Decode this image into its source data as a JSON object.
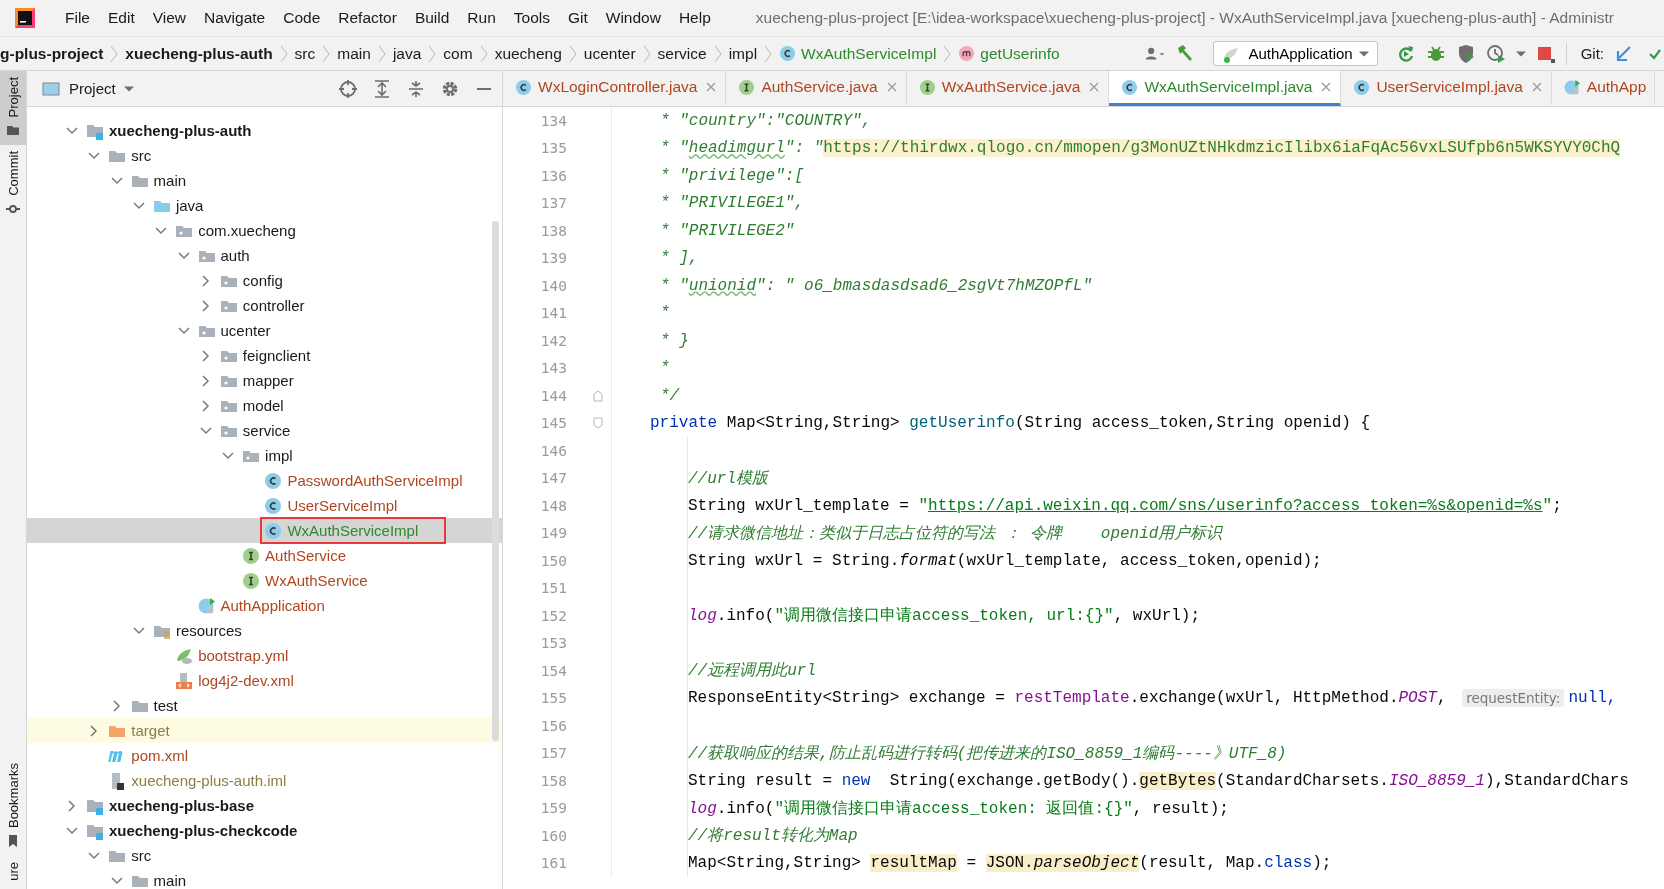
{
  "window": {
    "title": "xuecheng-plus-project [E:\\idea-workspace\\xuecheng-plus-project] - WxAuthServiceImpl.java [xuecheng-plus-auth] - Administr"
  },
  "menu": [
    "File",
    "Edit",
    "View",
    "Navigate",
    "Code",
    "Refactor",
    "Build",
    "Run",
    "Tools",
    "Git",
    "Window",
    "Help"
  ],
  "breadcrumb": [
    {
      "label": "g-plus-project",
      "kind": "module"
    },
    {
      "label": "xuecheng-plus-auth",
      "kind": "module"
    },
    {
      "label": "src",
      "kind": "folder"
    },
    {
      "label": "main",
      "kind": "folder"
    },
    {
      "label": "java",
      "kind": "folder"
    },
    {
      "label": "com",
      "kind": "folder"
    },
    {
      "label": "xuecheng",
      "kind": "folder"
    },
    {
      "label": "ucenter",
      "kind": "folder"
    },
    {
      "label": "service",
      "kind": "folder"
    },
    {
      "label": "impl",
      "kind": "folder"
    },
    {
      "label": "WxAuthServiceImpl",
      "kind": "class"
    },
    {
      "label": "getUserinfo",
      "kind": "method"
    }
  ],
  "toolbar": {
    "run_config": "AuthApplication",
    "git_label": "Git:"
  },
  "side_stripe": [
    {
      "label": "Project",
      "kind": "top",
      "selected": true
    },
    {
      "label": "Commit",
      "kind": "top",
      "selected": false
    },
    {
      "label": "Bookmarks",
      "kind": "bottom",
      "selected": false
    },
    {
      "label": "ure",
      "kind": "bottom",
      "selected": false
    }
  ],
  "project_panel": {
    "title": "Project",
    "tree": [
      {
        "label": "xuecheng-plus-auth",
        "kind": "module",
        "expanded": true,
        "selected": false,
        "children": [
          {
            "label": "src",
            "kind": "folder",
            "expanded": true,
            "selected": false,
            "children": [
              {
                "label": "main",
                "kind": "folder",
                "expanded": true,
                "selected": false,
                "children": [
                  {
                    "label": "java",
                    "kind": "source",
                    "expanded": true,
                    "selected": false,
                    "children": [
                      {
                        "label": "com.xuecheng",
                        "kind": "package",
                        "expanded": true,
                        "selected": false,
                        "children": [
                          {
                            "label": "auth",
                            "kind": "package",
                            "expanded": true,
                            "selected": false,
                            "children": [
                              {
                                "label": "config",
                                "kind": "package",
                                "expanded": false,
                                "selected": false
                              },
                              {
                                "label": "controller",
                                "kind": "package",
                                "expanded": false,
                                "selected": false
                              }
                            ]
                          },
                          {
                            "label": "ucenter",
                            "kind": "package",
                            "expanded": true,
                            "selected": false,
                            "children": [
                              {
                                "label": "feignclient",
                                "kind": "package",
                                "expanded": false,
                                "selected": false
                              },
                              {
                                "label": "mapper",
                                "kind": "package",
                                "expanded": false,
                                "selected": false
                              },
                              {
                                "label": "model",
                                "kind": "package",
                                "expanded": false,
                                "selected": false
                              },
                              {
                                "label": "service",
                                "kind": "package",
                                "expanded": true,
                                "selected": false,
                                "children": [
                                  {
                                    "label": "impl",
                                    "kind": "package",
                                    "expanded": true,
                                    "selected": false,
                                    "children": [
                                      {
                                        "label": "PasswordAuthServiceImpl",
                                        "kind": "class",
                                        "selected": false,
                                        "color": "#b0461f"
                                      },
                                      {
                                        "label": "UserServiceImpl",
                                        "kind": "class",
                                        "selected": false,
                                        "color": "#b0461f"
                                      },
                                      {
                                        "label": "WxAuthServiceImpl",
                                        "kind": "class",
                                        "selected": true,
                                        "outlined": true,
                                        "color": "#2d8a2d"
                                      }
                                    ]
                                  },
                                  {
                                    "label": "AuthService",
                                    "kind": "interface",
                                    "selected": false,
                                    "color": "#b0461f"
                                  },
                                  {
                                    "label": "WxAuthService",
                                    "kind": "interface",
                                    "selected": false,
                                    "color": "#b0461f"
                                  }
                                ]
                              }
                            ]
                          },
                          {
                            "label": "AuthApplication",
                            "kind": "app",
                            "selected": false,
                            "color": "#b0461f"
                          }
                        ]
                      }
                    ]
                  },
                  {
                    "label": "resources",
                    "kind": "resources",
                    "expanded": true,
                    "selected": false,
                    "children": [
                      {
                        "label": "bootstrap.yml",
                        "kind": "yaml",
                        "selected": false,
                        "color": "#b0461f"
                      },
                      {
                        "label": "log4j2-dev.xml",
                        "kind": "xml",
                        "selected": false,
                        "color": "#b0461f"
                      }
                    ]
                  }
                ]
              },
              {
                "label": "test",
                "kind": "folder",
                "expanded": false,
                "selected": false
              }
            ]
          },
          {
            "label": "target",
            "kind": "excluded",
            "expanded": false,
            "selected": false,
            "color": "#8a7f45"
          },
          {
            "label": "pom.xml",
            "kind": "maven",
            "selected": false,
            "color": "#b0461f"
          },
          {
            "label": "xuecheng-plus-auth.iml",
            "kind": "iml",
            "selected": false,
            "color": "#8a7f45"
          }
        ]
      },
      {
        "label": "xuecheng-plus-base",
        "kind": "module",
        "expanded": false,
        "selected": false
      },
      {
        "label": "xuecheng-plus-checkcode",
        "kind": "module",
        "expanded": true,
        "selected": false,
        "children": [
          {
            "label": "src",
            "kind": "folder",
            "expanded": true,
            "selected": false,
            "children": [
              {
                "label": "main",
                "kind": "folder",
                "expanded": true,
                "selected": false
              }
            ]
          }
        ]
      }
    ]
  },
  "editor": {
    "tabs": [
      {
        "label": "WxLoginController.java",
        "kind": "class",
        "selected": false,
        "closable": true,
        "color": "#b0461f"
      },
      {
        "label": "AuthService.java",
        "kind": "interface",
        "selected": false,
        "closable": true,
        "color": "#b0461f"
      },
      {
        "label": "WxAuthService.java",
        "kind": "interface",
        "selected": false,
        "closable": true,
        "color": "#b0461f"
      },
      {
        "label": "WxAuthServiceImpl.java",
        "kind": "class",
        "selected": true,
        "closable": true,
        "color": "#2d8a2d"
      },
      {
        "label": "UserServiceImpl.java",
        "kind": "class",
        "selected": false,
        "closable": true,
        "color": "#b0461f"
      },
      {
        "label": "AuthApp",
        "kind": "app",
        "selected": false,
        "closable": false,
        "color": "#b0461f"
      }
    ],
    "lines": [
      {
        "number": "134",
        "kind": "doc",
        "tokens": [
          {
            "kind": "doc",
            "text": "* \"country\":\"COUNTRY\","
          }
        ]
      },
      {
        "number": "135",
        "kind": "doc",
        "tokens": [
          {
            "kind": "doc",
            "text": "* \""
          },
          {
            "kind": "doc-typo",
            "text": "headimgurl"
          },
          {
            "kind": "doc",
            "text": "\": \""
          },
          {
            "kind": "doc-link",
            "text": "https://thirdwx.qlogo.cn/mmopen/g3MonUZtNHkdmzicIlibx6iaFqAc56vxLSUfpb6n5WKSYVY0ChQ"
          }
        ]
      },
      {
        "number": "136",
        "kind": "doc",
        "tokens": [
          {
            "kind": "doc",
            "text": "* \"privilege\":["
          }
        ]
      },
      {
        "number": "137",
        "kind": "doc",
        "tokens": [
          {
            "kind": "doc",
            "text": "* \"PRIVILEGE1\","
          }
        ]
      },
      {
        "number": "138",
        "kind": "doc",
        "tokens": [
          {
            "kind": "doc",
            "text": "* \"PRIVILEGE2\""
          }
        ]
      },
      {
        "number": "139",
        "kind": "doc",
        "tokens": [
          {
            "kind": "doc",
            "text": "* ],"
          }
        ]
      },
      {
        "number": "140",
        "kind": "doc",
        "tokens": [
          {
            "kind": "doc",
            "text": "* \""
          },
          {
            "kind": "doc-typo",
            "text": "unionid"
          },
          {
            "kind": "doc",
            "text": "\": \" o6_bmasdasdsad6_2sgVt7hMZOPfL\""
          }
        ]
      },
      {
        "number": "141",
        "kind": "doc",
        "tokens": [
          {
            "kind": "doc",
            "text": "*"
          }
        ]
      },
      {
        "number": "142",
        "kind": "doc",
        "tokens": [
          {
            "kind": "doc",
            "text": "* }"
          }
        ]
      },
      {
        "number": "143",
        "kind": "doc",
        "tokens": [
          {
            "kind": "doc",
            "text": "*"
          }
        ]
      },
      {
        "number": "144",
        "kind": "doc",
        "fold_end": true,
        "tokens": [
          {
            "kind": "doc",
            "text": "*/"
          }
        ]
      },
      {
        "number": "145",
        "kind": "member",
        "fold_start": true,
        "tokens": [
          {
            "kind": "keyword",
            "text": "private"
          },
          {
            "kind": "plain",
            "text": " Map<String,String> "
          },
          {
            "kind": "decl",
            "text": "getUserinfo"
          },
          {
            "kind": "plain",
            "text": "(String access_token,String openid) {"
          }
        ]
      },
      {
        "number": "146",
        "kind": "blank"
      },
      {
        "number": "147",
        "kind": "body",
        "tokens": [
          {
            "kind": "comment",
            "text": "//url模版"
          }
        ]
      },
      {
        "number": "148",
        "kind": "body",
        "tokens": [
          {
            "kind": "plain",
            "text": "String wxUrl_template = "
          },
          {
            "kind": "string",
            "text": "\""
          },
          {
            "kind": "url",
            "text": "https://api.weixin.qq.com/sns/userinfo?access_token=%s&openid=%s"
          },
          {
            "kind": "string",
            "text": "\""
          },
          {
            "kind": "plain",
            "text": ";"
          }
        ]
      },
      {
        "number": "149",
        "kind": "body",
        "tokens": [
          {
            "kind": "comment",
            "text": "//请求微信地址：类似于日志占位符的写法 ： 令牌    openid用户标识"
          }
        ]
      },
      {
        "number": "150",
        "kind": "body",
        "tokens": [
          {
            "kind": "plain",
            "text": "String wxUrl = String."
          },
          {
            "kind": "static-call",
            "text": "format"
          },
          {
            "kind": "plain",
            "text": "(wxUrl_template, access_token,openid);"
          }
        ]
      },
      {
        "number": "151",
        "kind": "blank"
      },
      {
        "number": "152",
        "kind": "body",
        "tokens": [
          {
            "kind": "static",
            "text": "log"
          },
          {
            "kind": "plain",
            "text": ".info("
          },
          {
            "kind": "string",
            "text": "\"调用微信接口申请access_token, url:{}\""
          },
          {
            "kind": "plain",
            "text": ", wxUrl);"
          }
        ]
      },
      {
        "number": "153",
        "kind": "blank"
      },
      {
        "number": "154",
        "kind": "body",
        "tokens": [
          {
            "kind": "comment",
            "text": "//远程调用此url"
          }
        ]
      },
      {
        "number": "155",
        "kind": "body",
        "tokens": [
          {
            "kind": "plain",
            "text": "ResponseEntity<String> exchange = "
          },
          {
            "kind": "field",
            "text": "restTemplate"
          },
          {
            "kind": "plain",
            "text": ".exchange(wxUrl, HttpMethod."
          },
          {
            "kind": "static",
            "text": "POST"
          },
          {
            "kind": "plain",
            "text": ", "
          },
          {
            "kind": "hint",
            "text": "requestEntity:"
          },
          {
            "kind": "keyword",
            "text": "null,"
          }
        ]
      },
      {
        "number": "156",
        "kind": "blank"
      },
      {
        "number": "157",
        "kind": "body",
        "tokens": [
          {
            "kind": "comment",
            "text": "//获取响应的结果,防止乱码进行转码(把传进来的ISO_8859_1编码----》UTF_8)"
          }
        ]
      },
      {
        "number": "158",
        "kind": "body",
        "tokens": [
          {
            "kind": "plain",
            "text": "String result = "
          },
          {
            "kind": "keyword",
            "text": "new"
          },
          {
            "kind": "plain",
            "text": "  String(exchange.getBody()."
          },
          {
            "kind": "mark",
            "text": "getBytes"
          },
          {
            "kind": "plain",
            "text": "(StandardCharsets."
          },
          {
            "kind": "static",
            "text": "ISO_8859_1"
          },
          {
            "kind": "plain",
            "text": "),StandardChars"
          }
        ]
      },
      {
        "number": "159",
        "kind": "body",
        "tokens": [
          {
            "kind": "static",
            "text": "log"
          },
          {
            "kind": "plain",
            "text": ".info("
          },
          {
            "kind": "string",
            "text": "\"调用微信接口申请access_token: 返回值:{}\""
          },
          {
            "kind": "plain",
            "text": ", result);"
          }
        ]
      },
      {
        "number": "160",
        "kind": "body",
        "tokens": [
          {
            "kind": "comment",
            "text": "//将result转化为Map"
          }
        ]
      },
      {
        "number": "161",
        "kind": "body",
        "tokens": [
          {
            "kind": "plain",
            "text": "Map<String,String> "
          },
          {
            "kind": "mark",
            "text": "resultMap"
          },
          {
            "kind": "plain",
            "text": " = "
          },
          {
            "kind": "mark",
            "text": "JSON."
          },
          {
            "kind": "mark-call",
            "text": "parseObject"
          },
          {
            "kind": "plain",
            "text": "(result, Map."
          },
          {
            "kind": "keyword",
            "text": "class"
          },
          {
            "kind": "plain",
            "text": ");"
          }
        ]
      }
    ]
  }
}
